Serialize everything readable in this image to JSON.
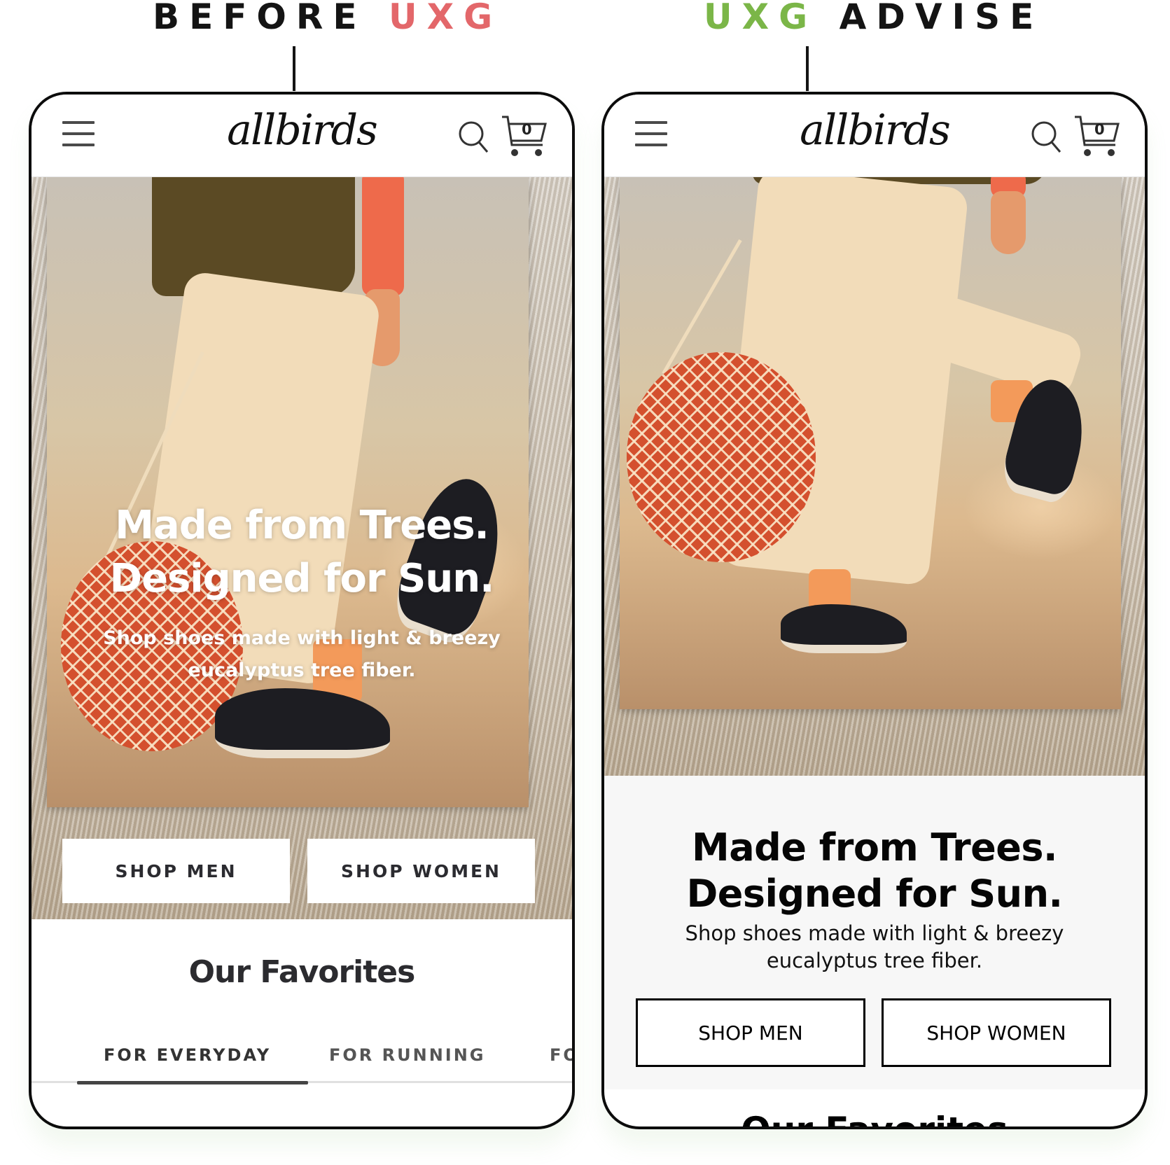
{
  "headings": {
    "before_prefix": "BEFORE",
    "before_brand": "UXG",
    "after_brand": "UXG",
    "after_suffix": "ADVISE"
  },
  "colors": {
    "before_accent": "#e3676a",
    "after_accent": "#7bb648",
    "text_dark": "#141414"
  },
  "phones": {
    "before": {
      "nav": {
        "menu_icon": "hamburger-menu-icon",
        "logo": "allbirds",
        "search_icon": "search-icon",
        "cart_icon": "cart-icon",
        "cart_count": "0"
      },
      "hero": {
        "title_line1": "Made from Trees.",
        "title_line2": "Designed for Sun.",
        "subtitle_line1": "Shop shoes made with light & breezy",
        "subtitle_line2": "eucalyptus tree fiber."
      },
      "buttons": {
        "shop_men": "SHOP MEN",
        "shop_women": "SHOP WOMEN"
      },
      "favorites": {
        "title": "Our Favorites",
        "tabs": [
          {
            "label": "FOR EVERYDAY",
            "active": true
          },
          {
            "label": "FOR RUNNING",
            "active": false
          },
          {
            "label": "FO",
            "active": false
          }
        ]
      }
    },
    "after": {
      "nav": {
        "menu_icon": "hamburger-menu-icon",
        "logo": "allbirds",
        "search_icon": "search-icon",
        "cart_icon": "cart-icon",
        "cart_count": "0"
      },
      "hero": {
        "title_line1": "Made from Trees.",
        "title_line2": "Designed for Sun.",
        "subtitle_line1": "Shop shoes made with light & breezy",
        "subtitle_line2": "eucalyptus tree fiber."
      },
      "buttons": {
        "shop_men": "SHOP MEN",
        "shop_women": "SHOP WOMEN"
      },
      "favorites": {
        "title": "Our Favorites"
      }
    }
  }
}
